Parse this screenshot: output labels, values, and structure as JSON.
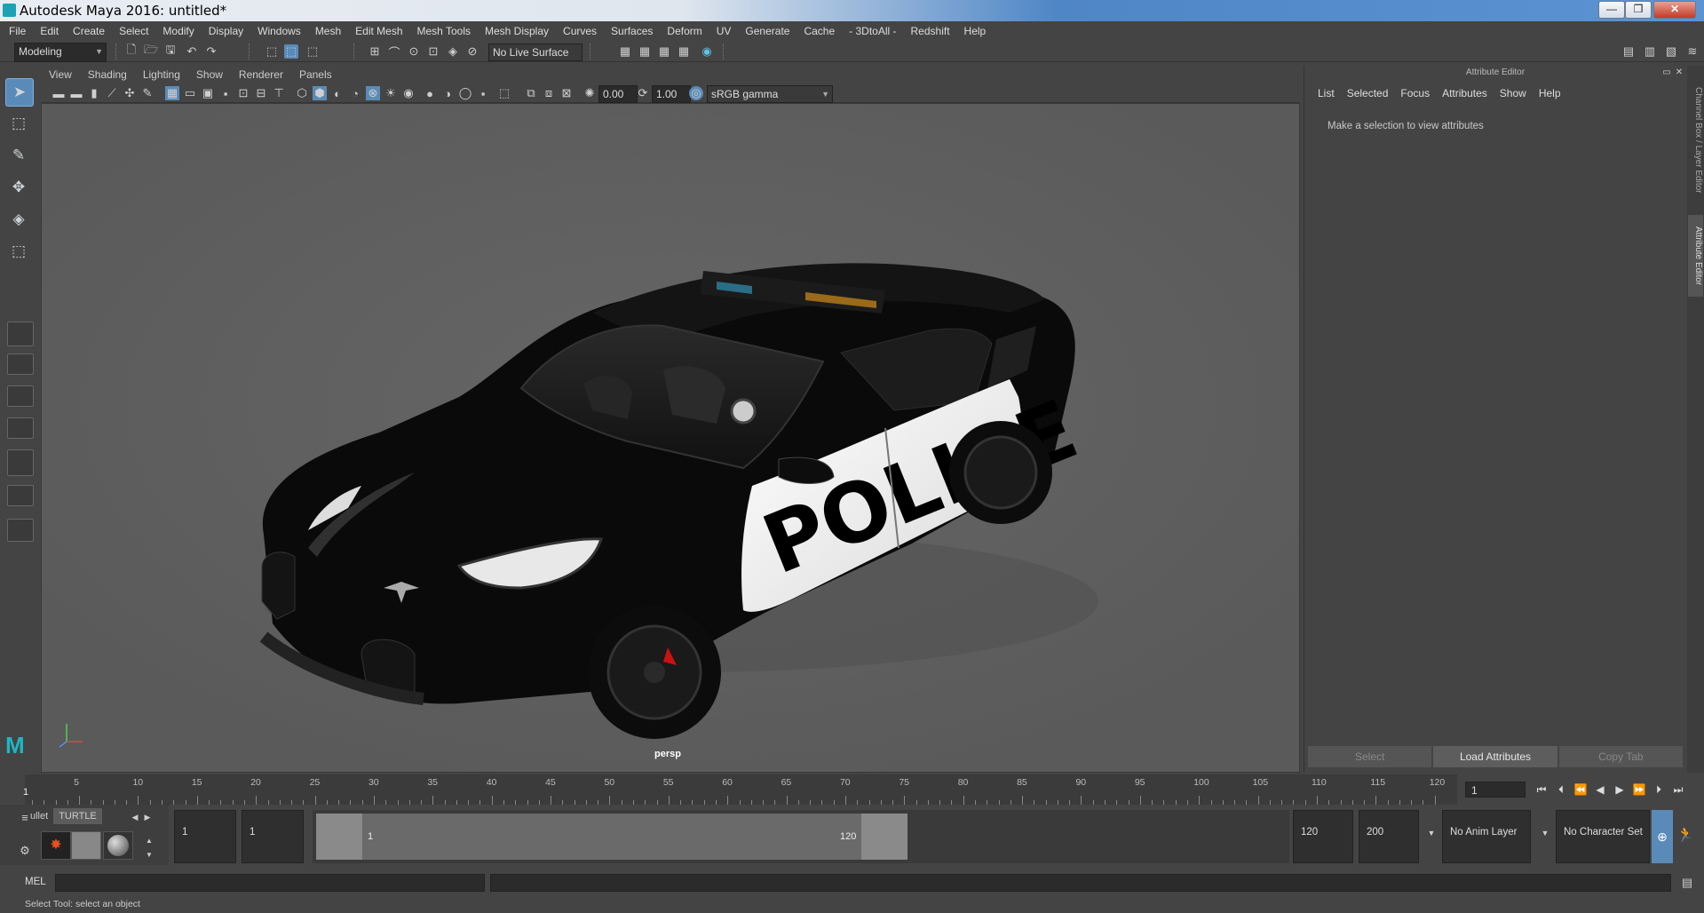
{
  "window": {
    "title": "Autodesk Maya 2016: untitled*",
    "btn_min": "—",
    "btn_max": "❒",
    "btn_close": "✕"
  },
  "menu": [
    "File",
    "Edit",
    "Create",
    "Select",
    "Modify",
    "Display",
    "Windows",
    "Mesh",
    "Edit Mesh",
    "Mesh Tools",
    "Mesh Display",
    "Curves",
    "Surfaces",
    "Deform",
    "UV",
    "Generate",
    "Cache",
    "- 3DtoAll -",
    "Redshift",
    "Help"
  ],
  "status": {
    "mode": "Modeling",
    "live_surface": "No Live Surface"
  },
  "viewport": {
    "menu": [
      "View",
      "Shading",
      "Lighting",
      "Show",
      "Renderer",
      "Panels"
    ],
    "exposure": "0.00",
    "gamma": "1.00",
    "colorspace": "sRGB gamma",
    "camera": "persp",
    "car_text": "POLICE"
  },
  "attribute_editor": {
    "title": "Attribute Editor",
    "menu": [
      "List",
      "Selected",
      "Focus",
      "Attributes",
      "Show",
      "Help"
    ],
    "message": "Make a selection to view attributes",
    "buttons": [
      "Select",
      "Load Attributes",
      "Copy Tab"
    ]
  },
  "side_tabs": [
    "Channel Box / Layer Editor",
    "Attribute Editor"
  ],
  "timeline": {
    "ticks": [
      "5",
      "10",
      "15",
      "20",
      "25",
      "30",
      "35",
      "40",
      "45",
      "50",
      "55",
      "60",
      "65",
      "70",
      "75",
      "80",
      "85",
      "90",
      "95",
      "100",
      "105",
      "110",
      "115",
      "120"
    ],
    "start_marker": "1",
    "current_frame": "1"
  },
  "range": {
    "shelf_tabs": [
      "ullet",
      "TURTLE"
    ],
    "start_time": "1",
    "playback_start": "1",
    "range_start_label": "1",
    "range_end_label": "120",
    "playback_end": "120",
    "end_time": "200",
    "anim_layer": "No Anim Layer",
    "character_set": "No Character Set"
  },
  "command": {
    "label": "MEL"
  },
  "help": {
    "text": "Select Tool: select an object"
  },
  "colors": {
    "accent": "#5a8bb8",
    "viewport_bg": "#5f5f5f",
    "panel": "#444444"
  }
}
